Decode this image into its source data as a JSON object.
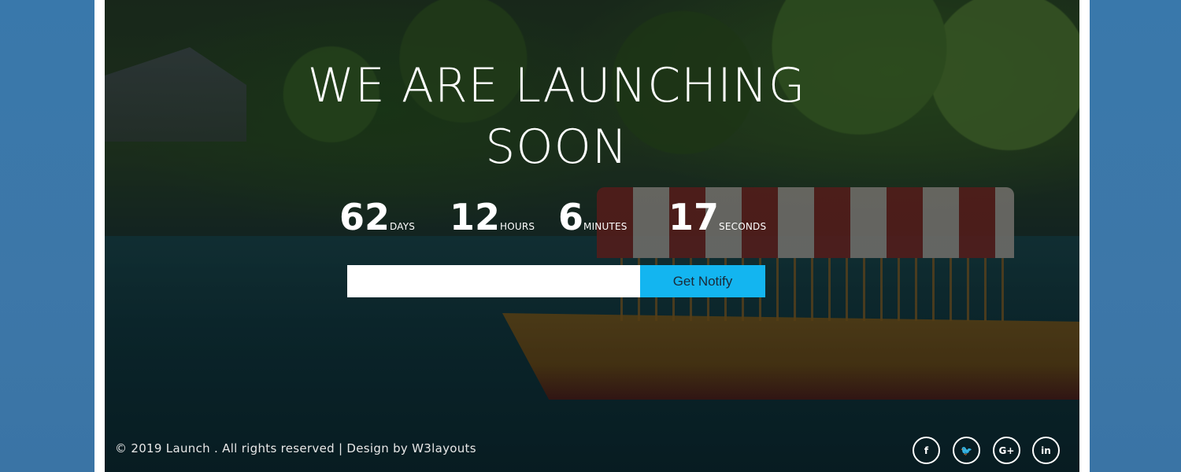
{
  "headline": {
    "line1": "WE ARE LAUNCHING",
    "line2": "SOON"
  },
  "countdown": [
    {
      "value": "62",
      "label": "DAYS"
    },
    {
      "value": "12",
      "label": "HOURS"
    },
    {
      "value": "6",
      "label": "MINUTES"
    },
    {
      "value": "17",
      "label": "SECONDS"
    }
  ],
  "notify_form": {
    "email_value": "",
    "email_placeholder": "",
    "button_label": "Get Notify"
  },
  "footer": {
    "copyright": "© 2019 Launch . All rights reserved | Design by W3layouts"
  },
  "social": [
    {
      "icon": "facebook-icon",
      "glyph": "f"
    },
    {
      "icon": "twitter-icon",
      "glyph": "🐦"
    },
    {
      "icon": "google-plus-icon",
      "glyph": "G+"
    },
    {
      "icon": "linkedin-icon",
      "glyph": "in"
    }
  ],
  "colors": {
    "page_background": "#3b76a9",
    "notify_button": "#13b5f0",
    "text": "#ffffff"
  }
}
